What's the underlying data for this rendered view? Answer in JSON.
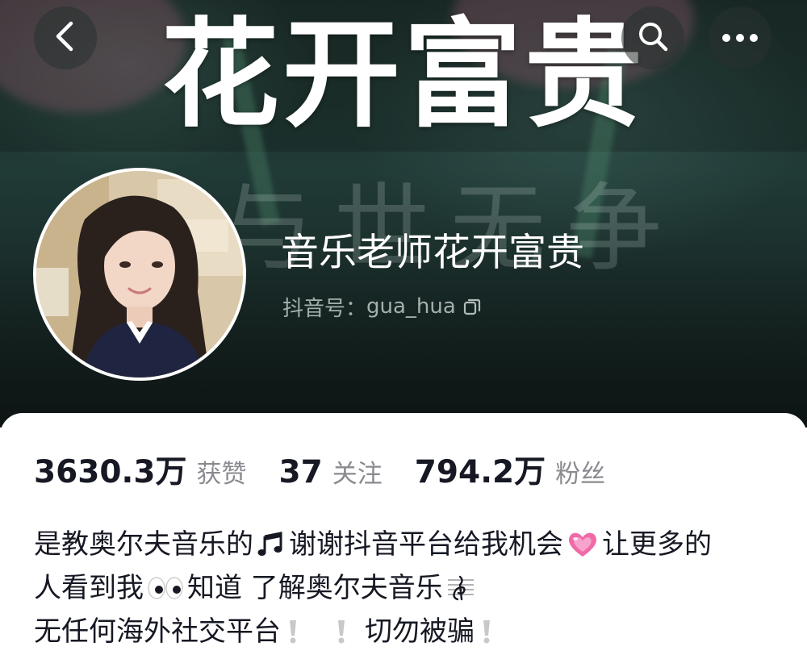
{
  "banner": {
    "title": "花开富贵",
    "motto": "与世无争"
  },
  "nav": {
    "back_icon": "chevron-left-icon",
    "search_icon": "search-icon",
    "more_icon": "more-icon"
  },
  "profile": {
    "display_name": "音乐老师花开富贵",
    "id_label": "抖音号：",
    "id_value": "gua_hua"
  },
  "stats": [
    {
      "value": "3630.3万",
      "label": "获赞"
    },
    {
      "value": "37",
      "label": "关注"
    },
    {
      "value": "794.2万",
      "label": "粉丝"
    }
  ],
  "bio": {
    "line1_a": "是教奥尔夫音乐的",
    "line1_b": "谢谢抖音平台给我机会",
    "line1_c": "让更多的",
    "line2_a": "人看到我",
    "line2_b": "知道 了解奥尔夫音乐",
    "line3_a": "无任何海外社交平台",
    "line3_b": "切勿被骗"
  },
  "colors": {
    "text_primary": "#161823",
    "text_secondary": "#8a8b91",
    "warning_mark": "#c8c8c8",
    "heart": "#f06aa8"
  }
}
